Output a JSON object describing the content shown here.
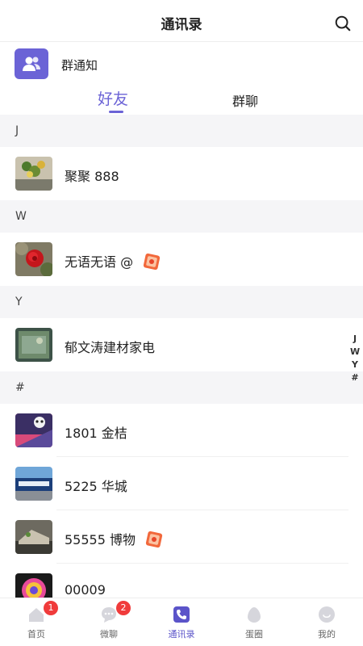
{
  "header": {
    "title": "通讯录"
  },
  "group_notice": {
    "label": "群通知"
  },
  "tabs": [
    {
      "label": "好友"
    },
    {
      "label": "群聊"
    }
  ],
  "sections": [
    {
      "letter": "J",
      "contacts": [
        {
          "name": "聚聚 888"
        }
      ]
    },
    {
      "letter": "W",
      "contacts": [
        {
          "name": "无语无语 @"
        }
      ]
    },
    {
      "letter": "Y",
      "contacts": [
        {
          "name": "郁文涛建材家电"
        }
      ]
    },
    {
      "letter": "#",
      "contacts": [
        {
          "name": "1801 金桔"
        },
        {
          "name": "5225 华城"
        },
        {
          "name": "55555 博物"
        },
        {
          "name": "00009"
        }
      ]
    }
  ],
  "index_bar": [
    "J",
    "W",
    "Y",
    "#"
  ],
  "tabbar": [
    {
      "label": "首页",
      "badge": "1"
    },
    {
      "label": "微聊",
      "badge": "2"
    },
    {
      "label": "通讯录"
    },
    {
      "label": "蛋圈"
    },
    {
      "label": "我的"
    }
  ],
  "colors": {
    "accent": "#6b63d6",
    "badge": "#f03b3b",
    "section_bg": "#f5f5f7"
  }
}
